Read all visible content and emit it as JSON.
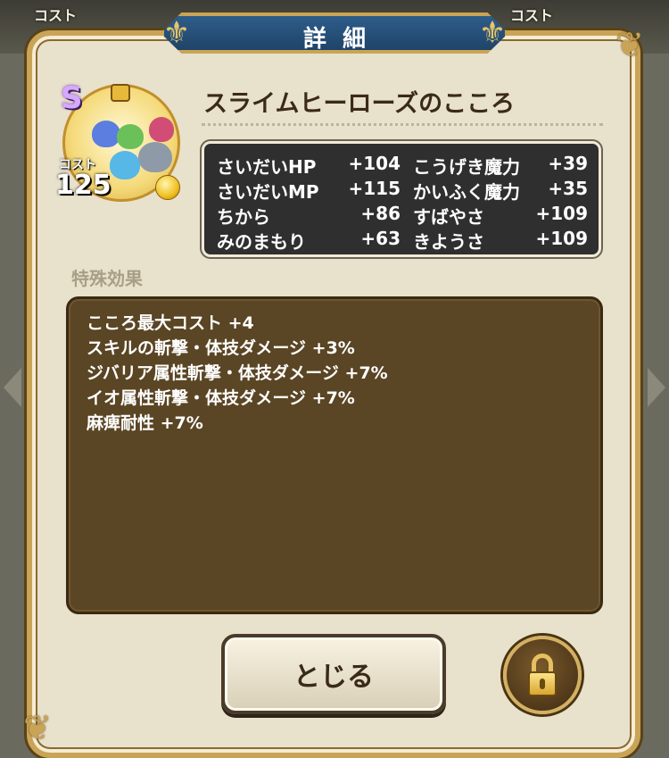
{
  "background": {
    "cost_left": "コスト",
    "cost_right": "コスト"
  },
  "dialog": {
    "title": "詳細",
    "item": {
      "rank": "S",
      "cost_label": "コスト",
      "cost_value": "125",
      "name": "スライムヒーローズのこころ"
    },
    "stats": [
      {
        "name": "さいだいHP",
        "value": "+104"
      },
      {
        "name": "さいだいMP",
        "value": "+115"
      },
      {
        "name": "ちから",
        "value": "+86"
      },
      {
        "name": "みのまもり",
        "value": "+63"
      },
      {
        "name": "こうげき魔力",
        "value": "+39"
      },
      {
        "name": "かいふく魔力",
        "value": "+35"
      },
      {
        "name": "すばやさ",
        "value": "+109"
      },
      {
        "name": "きようさ",
        "value": "+109"
      }
    ],
    "special_label": "特殊効果",
    "effects": [
      "こころ最大コスト +4",
      "スキルの斬撃・体技ダメージ +3%",
      "ジバリア属性斬撃・体技ダメージ +7%",
      "イオ属性斬撃・体技ダメージ +7%",
      "麻痺耐性 +7%"
    ],
    "close_label": "とじる"
  },
  "colors": {
    "title_plate": "#1f4468",
    "gold_border": "#c9a456",
    "panel": "#e8e1cc",
    "effects_bg": "#5a4524",
    "stats_bg": "#2f2f2f"
  },
  "icons": [
    "lock-icon",
    "gold-orb-icon",
    "fleur-ornament-icon"
  ]
}
